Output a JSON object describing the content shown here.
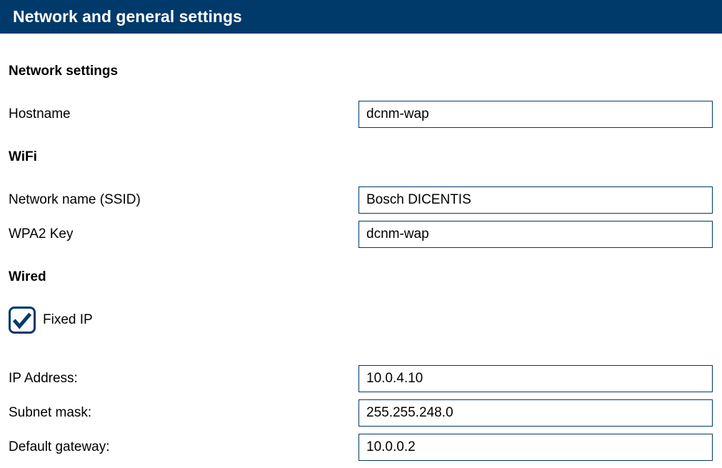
{
  "header": {
    "title": "Network and general settings"
  },
  "sections": {
    "network": {
      "heading": "Network settings",
      "hostname_label": "Hostname",
      "hostname_value": "dcnm-wap"
    },
    "wifi": {
      "heading": "WiFi",
      "ssid_label": "Network name (SSID)",
      "ssid_value": "Bosch DICENTIS",
      "wpa2_label": "WPA2 Key",
      "wpa2_value": "dcnm-wap"
    },
    "wired": {
      "heading": "Wired",
      "fixed_ip_label": "Fixed IP",
      "fixed_ip_checked": true,
      "ip_label": "IP Address:",
      "ip_value": "10.0.4.10",
      "subnet_label": "Subnet mask:",
      "subnet_value": "255.255.248.0",
      "gateway_label": "Default gateway:",
      "gateway_value": "10.0.0.2"
    }
  }
}
